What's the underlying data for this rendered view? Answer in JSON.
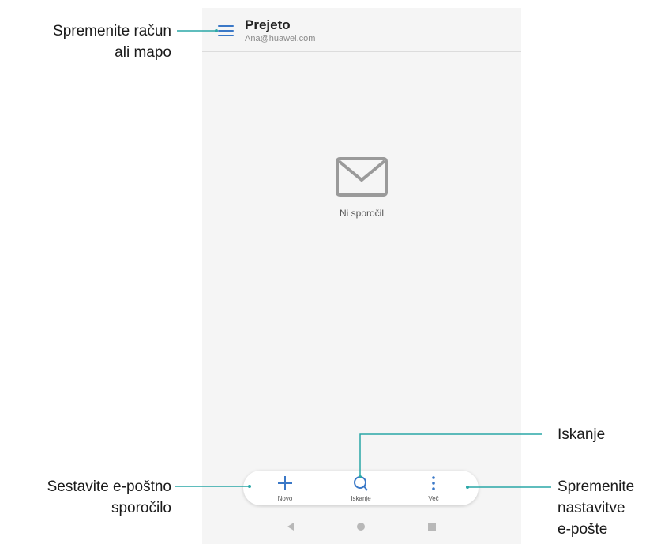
{
  "header": {
    "title": "Prejeto",
    "account": "Ana@huawei.com"
  },
  "main": {
    "empty_text": "Ni sporočil"
  },
  "bottom_bar": {
    "items": [
      {
        "label": "Novo",
        "icon": "plus-icon"
      },
      {
        "label": "Iskanje",
        "icon": "search-icon"
      },
      {
        "label": "Več",
        "icon": "more-vertical-icon"
      }
    ]
  },
  "nav_bar": {
    "icons": [
      "back-icon",
      "home-icon",
      "recents-icon"
    ]
  },
  "callouts": {
    "switch_account": [
      "Spremenite račun",
      "ali mapo"
    ],
    "compose": [
      "Sestavite e-poštno",
      "sporočilo"
    ],
    "search": [
      "Iskanje"
    ],
    "settings": [
      "Spremenite",
      "nastavitve",
      "e-pošte"
    ]
  },
  "colors": {
    "accent": "#3a78c7",
    "callout_line": "#2aa7a7"
  }
}
